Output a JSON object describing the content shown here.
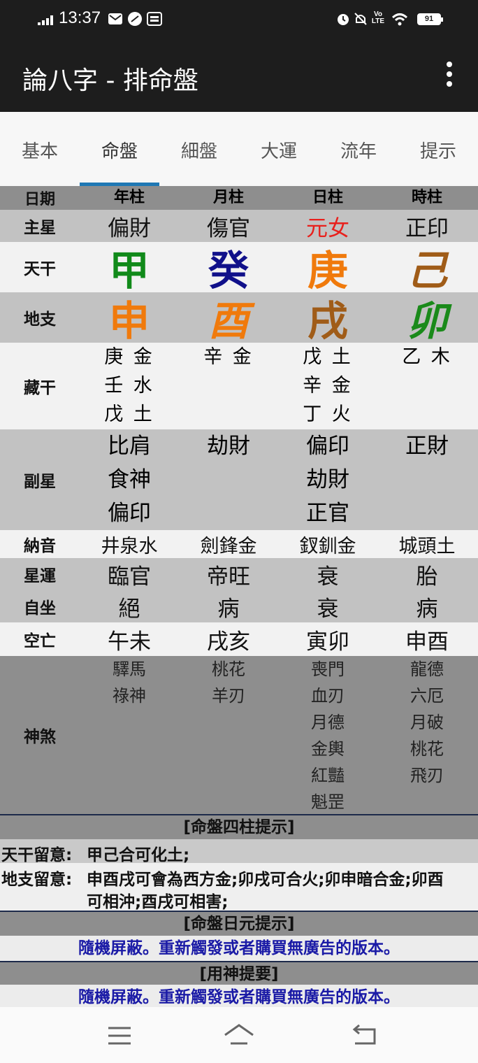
{
  "status_bar": {
    "time": "13:37",
    "battery": "91",
    "icons": [
      "signal-icon",
      "mail-icon",
      "app-icon",
      "news-icon",
      "alarm-icon",
      "mute-icon",
      "volte-icon",
      "wifi-icon",
      "battery-icon"
    ]
  },
  "app_bar": {
    "title": "論八字 - 排命盤",
    "menu_icon": "more-vert-icon"
  },
  "tabs": [
    {
      "label": "基本"
    },
    {
      "label": "命盤"
    },
    {
      "label": "細盤"
    },
    {
      "label": "大運"
    },
    {
      "label": "流年"
    },
    {
      "label": "提示"
    }
  ],
  "active_tab": "命盤",
  "table": {
    "header": {
      "label": "日期",
      "cols": [
        "年柱",
        "月柱",
        "日柱",
        "時柱"
      ]
    },
    "main_star": {
      "label": "主星",
      "cols": [
        "偏財",
        "傷官",
        "元女",
        "正印"
      ]
    },
    "heavenly_stem": {
      "label": "天干",
      "cols": [
        "甲",
        "癸",
        "庚",
        "己"
      ],
      "colors": [
        "#118a1a",
        "#10108a",
        "#f07a0c",
        "#a05c18"
      ]
    },
    "earthly_branch": {
      "label": "地支",
      "cols": [
        "申",
        "酉",
        "戌",
        "卯"
      ],
      "colors": [
        "#f07a0c",
        "#f07a0c",
        "#a05c18",
        "#1a8a1a"
      ]
    },
    "hidden_stems": {
      "label": "藏干",
      "cols": [
        [
          "庚 金",
          "壬 水",
          "戊 土"
        ],
        [
          "辛 金"
        ],
        [
          "戊 土",
          "辛 金",
          "丁 火"
        ],
        [
          "乙 木"
        ]
      ]
    },
    "sub_star": {
      "label": "副星",
      "cols": [
        [
          "比肩",
          "食神",
          "偏印"
        ],
        [
          "劫財"
        ],
        [
          "偏印",
          "劫財",
          "正官"
        ],
        [
          "正財"
        ]
      ]
    },
    "nayin": {
      "label": "納音",
      "cols": [
        "井泉水",
        "劍鋒金",
        "釵釧金",
        "城頭土"
      ]
    },
    "star_luck": {
      "label": "星運",
      "cols": [
        "臨官",
        "帝旺",
        "衰",
        "胎"
      ]
    },
    "self_seat": {
      "label": "自坐",
      "cols": [
        "絕",
        "病",
        "衰",
        "病"
      ]
    },
    "void": {
      "label": "空亡",
      "cols": [
        "午未",
        "戌亥",
        "寅卯",
        "申酉"
      ]
    },
    "shensha": {
      "label": "神煞",
      "cols": [
        [
          "驛馬",
          "祿神"
        ],
        [
          "桃花",
          "羊刃"
        ],
        [
          "喪門",
          "血刃",
          "月德",
          "金輿",
          "紅豔",
          "魁罡"
        ],
        [
          "龍德",
          "六厄",
          "月破",
          "桃花",
          "飛刃"
        ]
      ]
    }
  },
  "colors": {
    "day_master": "#e8201c",
    "appbar": "#1d1d1d",
    "accent": "#1f78b4",
    "notice": "#1a1aa6"
  },
  "hints": {
    "pillars_title": "[命盤四柱提示]",
    "stem_note_label": "天干留意:",
    "stem_note": "甲己合可化土;",
    "branch_note_label": "地支留意:",
    "branch_note_line1": "申酉戌可會為西方金;卯戌可合火;卯申暗合金;卯酉",
    "branch_note_line2": "可相沖;酉戌可相害;",
    "day_master_title": "[命盤日元提示]",
    "day_master_notice": "隨機屏蔽。重新觸發或者購買無廣告的版本。",
    "useful_god_title": "[用神提要]",
    "useful_god_notice": "隨機屏蔽。重新觸發或者購買無廣告的版本。"
  },
  "nav_bar": {
    "icons": [
      "recents-icon",
      "home-icon",
      "back-icon"
    ]
  }
}
